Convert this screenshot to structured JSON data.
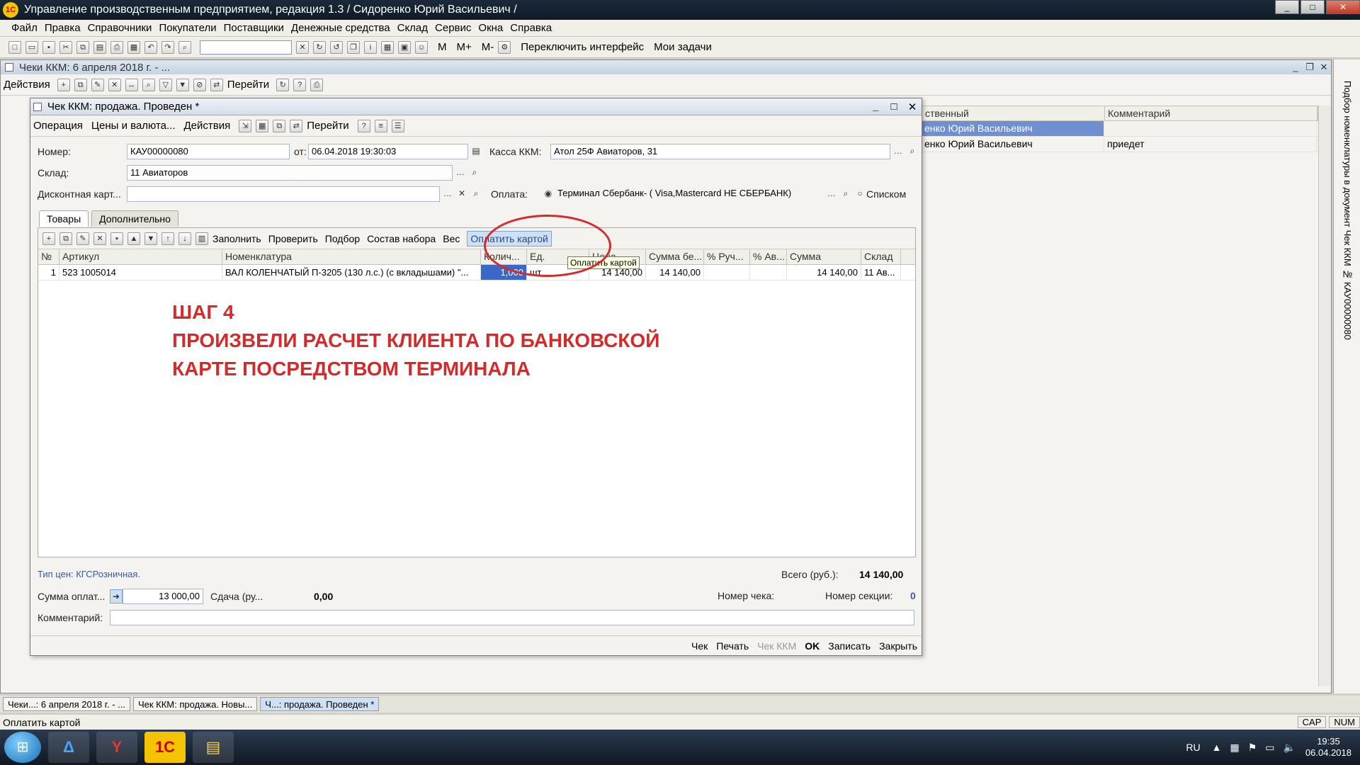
{
  "app": {
    "title": "Управление производственным предприятием, редакция 1.3 / Сидоренко Юрий Васильевич /",
    "logo": "1C"
  },
  "menu": [
    "Файл",
    "Правка",
    "Справочники",
    "Покупатели",
    "Поставщики",
    "Денежные средства",
    "Склад",
    "Сервис",
    "Окна",
    "Справка"
  ],
  "toolbar": {
    "switch_interface": "Переключить интерфейс",
    "my_tasks": "Мои задачи",
    "memory_buttons": [
      "M",
      "M+",
      "M-"
    ]
  },
  "bg_window": {
    "title": "Чеки ККМ: 6 апреля 2018 г. - ...",
    "actions": "Действия",
    "goto": "Перейти",
    "columns": [
      "ственный",
      "Комментарий"
    ],
    "rows": [
      {
        "resp": "енко Юрий Васильевич",
        "comment": ""
      },
      {
        "resp": "енко Юрий Васильевич",
        "comment": "приедет"
      }
    ]
  },
  "side_panel": {
    "text": "Подбор номенклатуры в документ Чек ККМ № КАУ00000080"
  },
  "dialog": {
    "title": "Чек ККМ: продажа. Проведен *",
    "actions": [
      "Операция",
      "Цены и валюта...",
      "Действия",
      "Перейти"
    ],
    "number_label": "Номер:",
    "number": "КАУ00000080",
    "date_label": "от:",
    "date": "06.04.2018 19:30:03",
    "kassa_label": "Касса ККМ:",
    "kassa": "Атол 25Ф Авиаторов, 31",
    "sklad_label": "Склад:",
    "sklad": "11 Авиаторов",
    "discount_label": "Дисконтная карт...",
    "discount": "",
    "payment_label": "Оплата:",
    "payment": "Терминал Сбербанк- ( Visa,Mastercard НЕ СБЕРБАНК)",
    "list_label": "Списком",
    "tabs": [
      "Товары",
      "Дополнительно"
    ],
    "grid_tools": [
      "Заполнить",
      "Проверить",
      "Подбор",
      "Состав набора",
      "Вес",
      "Оплатить картой"
    ],
    "tooltip": "Оплатить картой",
    "columns": [
      "№",
      "Артикул",
      "Номенклатура",
      "Колич...",
      "Ед.",
      "Цена",
      "Сумма бе...",
      "% Руч...",
      "% Ав...",
      "Сумма",
      "Склад"
    ],
    "rows": [
      {
        "n": "1",
        "article": "523 1005014",
        "name": "ВАЛ КОЛЕНЧАТЫЙ П-3205 (130 л.с.) (с вкладышами) \"...",
        "qty": "1,000",
        "unit": "шт",
        "price": "14 140,00",
        "sum_no_disc": "14 140,00",
        "manual": "",
        "auto": "",
        "sum": "14 140,00",
        "store": "11 Ав..."
      }
    ],
    "price_type": "Тип цен: КГСРозничная.",
    "total_label": "Всего (руб.):",
    "total": "14 140,00",
    "pay_sum_label": "Сумма оплат...",
    "pay_sum": "13 000,00",
    "change_label": "Сдача (ру...",
    "change": "0,00",
    "check_no_label": "Номер чека:",
    "section_label": "Номер секции:",
    "section": "0",
    "comment_label": "Комментарий:",
    "comment": "",
    "buttons": [
      "Чек",
      "Печать",
      "Чек ККМ",
      "OK",
      "Записать",
      "Закрыть"
    ]
  },
  "overlay": {
    "line1": "ШАГ 4",
    "line2": "ПРОИЗВЕЛИ РАСЧЕТ КЛИЕНТА ПО БАНКОВСКОЙ",
    "line3": "КАРТЕ  ПОСРЕДСТВОМ ТЕРМИНАЛА"
  },
  "window_tabs": [
    "Чеки...: 6 апреля 2018 г. - ...",
    "Чек ККМ: продажа. Новы...",
    "Ч...: продажа. Проведен *"
  ],
  "status": {
    "text": "Оплатить картой",
    "indicators": [
      "CAP",
      "NUM"
    ]
  },
  "os_tray": {
    "lang": "RU",
    "time": "19:35",
    "date": "06.04.2018"
  },
  "colors": {
    "annotation": "#d42a2a",
    "selection": "#3b67c8"
  }
}
